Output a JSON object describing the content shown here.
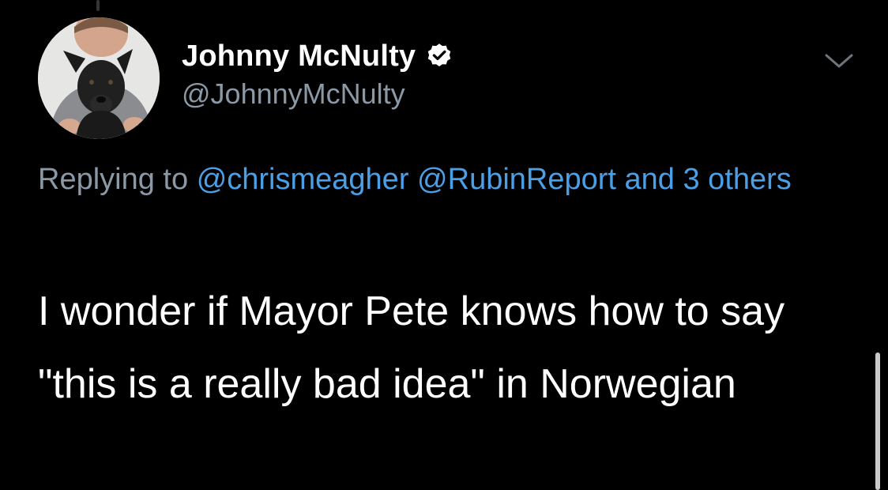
{
  "tweet": {
    "author": {
      "display_name": "Johnny McNulty",
      "handle": "@JohnnyMcNulty",
      "verified": true
    },
    "reply_context": {
      "prefix": "Replying to",
      "mentions": [
        "@chrismeagher",
        "@RubinReport"
      ],
      "and_others": "and 3 others"
    },
    "text": "I wonder if Mayor Pete knows how to say \"this is a really bad idea\" in Norwegian"
  },
  "colors": {
    "background": "#000000",
    "primary_text": "#ffffff",
    "secondary_text": "#8b98a5",
    "link": "#4a9fe6"
  },
  "icons": {
    "verified": "verified-badge-icon",
    "more": "chevron-down-icon"
  }
}
